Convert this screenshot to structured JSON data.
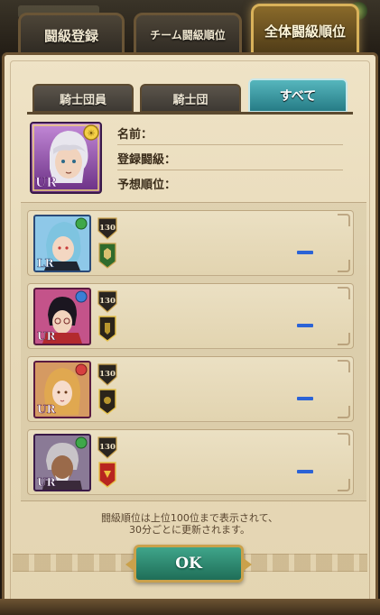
{
  "top_tabs": [
    {
      "label": "闘級登録",
      "active": false
    },
    {
      "label": "チーム闘級順位",
      "active": false
    },
    {
      "label": "全体闘級順位",
      "active": true
    }
  ],
  "filter_tabs": [
    {
      "label": "騎士団員",
      "active": false
    },
    {
      "label": "騎士団",
      "active": false
    },
    {
      "label": "すべて",
      "active": true
    }
  ],
  "my_info": {
    "rarity": "UR",
    "name_label": "名前：",
    "registered_grade_label": "登録闘級：",
    "predicted_rank_label": "予想順位："
  },
  "ranking_rows": [
    {
      "rarity": "LR",
      "level": "130",
      "rank": "—",
      "crest_color": "#2f6b2c",
      "avatar_bg": "#4aa3d8"
    },
    {
      "rarity": "UR",
      "level": "130",
      "rank": "—",
      "crest_color": "#2b241a",
      "avatar_bg": "#b2366a"
    },
    {
      "rarity": "UR",
      "level": "130",
      "rank": "—",
      "crest_color": "#2b241a",
      "avatar_bg": "#c9863a"
    },
    {
      "rarity": "UR",
      "level": "130",
      "rank": "—",
      "crest_color": "#b8261f",
      "avatar_bg": "#6b5a78"
    }
  ],
  "note_lines": [
    "闘級順位は上位100位まで表示されて、",
    "30分ごとに更新されます。"
  ],
  "ok_label": "OK",
  "colors": {
    "accent_teal": "#3d9ea8",
    "rank_blue": "#2b63d6",
    "frame_gold": "#caa14b"
  }
}
